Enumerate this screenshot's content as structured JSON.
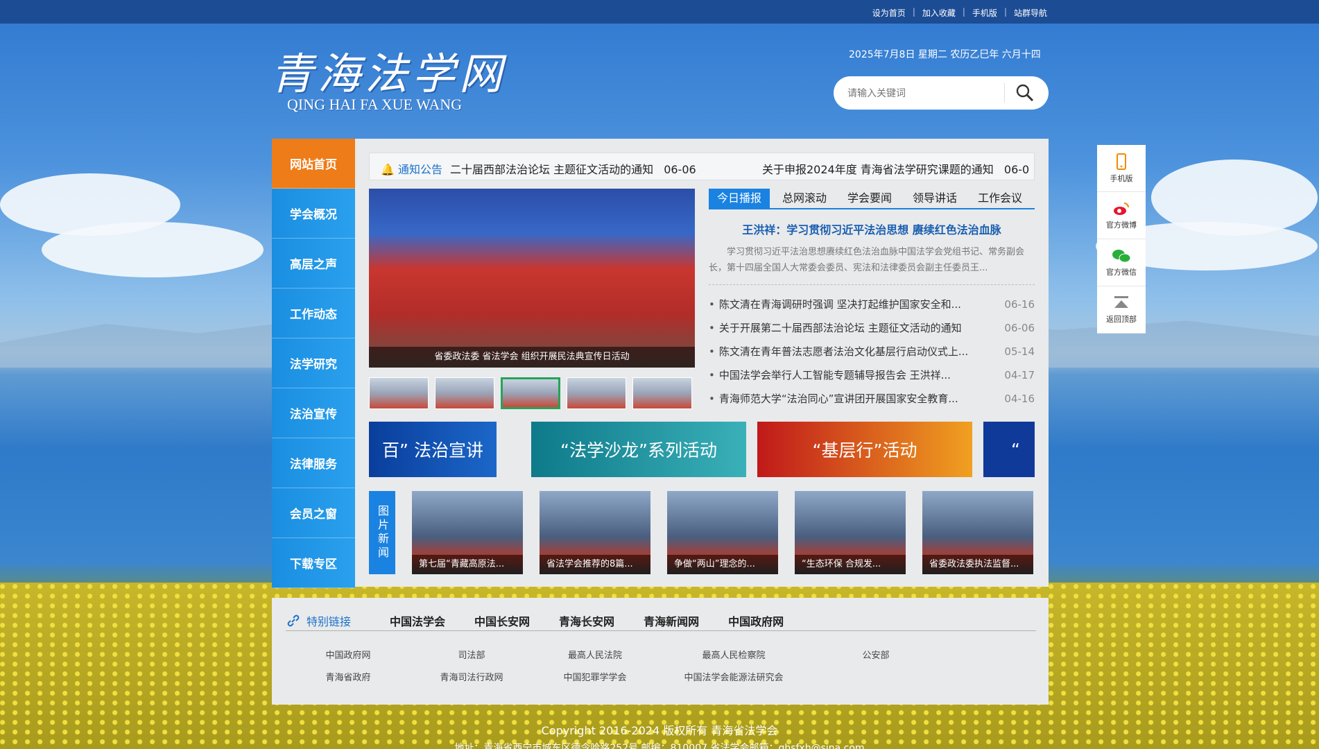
{
  "toplinks": [
    "设为首页",
    "加入收藏",
    "手机版",
    "站群导航"
  ],
  "logo": {
    "cn": "青海法学网",
    "en": "QING HAI FA XUE WANG"
  },
  "date": "2025年7月8日 星期二 农历乙巳年 六月十四",
  "search": {
    "placeholder": "请输入关键词"
  },
  "nav": [
    "网站首页",
    "学会概况",
    "高层之声",
    "工作动态",
    "法学研究",
    "法治宣传",
    "法律服务",
    "会员之窗",
    "下载专区"
  ],
  "notice": {
    "label": "通知公告",
    "items": [
      {
        "title": "二十届西部法治论坛 主题征文活动的通知",
        "date": "06-06"
      },
      {
        "title": "关于申报2024年度 青海省法学研究课题的通知",
        "date": "06-0"
      }
    ]
  },
  "slide": {
    "caption": "省委政法委 省法学会 组织开展民法典宣传日活动"
  },
  "tabs": [
    "今日播报",
    "总网滚动",
    "学会要闻",
    "领导讲话",
    "工作会议"
  ],
  "headline": "王洪祥：学习贯彻习近平法治思想 赓续红色法治血脉",
  "summary": "学习贯彻习近平法治思想赓续红色法治血脉中国法学会党组书记、常务副会长，第十四届全国人大常委会委员、宪法和法律委员会副主任委员王...",
  "news": [
    {
      "title": "陈文清在青海调研时强调 坚决打起维护国家安全和...",
      "date": "06-16"
    },
    {
      "title": "关于开展第二十届西部法治论坛 主题征文活动的通知",
      "date": "06-06"
    },
    {
      "title": "陈文清在青年普法志愿者法治文化基层行启动仪式上...",
      "date": "05-14"
    },
    {
      "title": "中国法学会举行人工智能专题辅导报告会 王洪祥...",
      "date": "04-17"
    },
    {
      "title": "青海师范大学“法治同心”宣讲团开展国家安全教育...",
      "date": "04-16"
    }
  ],
  "banners": [
    "百” 法治宣讲",
    "“法学沙龙”系列活动",
    "“基层行”活动",
    "“"
  ],
  "picnews": {
    "label": "图片新闻",
    "items": [
      "第七届“青藏高原法...",
      "省法学会推荐的8篇...",
      "争做“两山”理念的...",
      "“生态环保 合规发...",
      "省委政法委执法监督..."
    ]
  },
  "links": {
    "title": "特别链接",
    "head": [
      "中国法学会",
      "中国长安网",
      "青海长安网",
      "青海新闻网",
      "中国政府网"
    ],
    "row1": [
      "中国政府网",
      "司法部",
      "最高人民法院",
      "最高人民检察院",
      "公安部"
    ],
    "row2": [
      "青海省政府",
      "青海司法行政网",
      "中国犯罪学学会",
      "中国法学会能源法研究会"
    ]
  },
  "side": [
    "手机版",
    "官方微博",
    "官方微信",
    "返回顶部"
  ],
  "footer": {
    "copyright": "Copyright 2016-2024 版权所有  青海省法学会",
    "address": "地址：青海省西宁市城东区德令哈路252号  邮编：810007  省法学会邮箱：qhsfxh@sina.com"
  },
  "colors": {
    "accent": "#1a82e0",
    "nav_active": "#ee7c18",
    "topbar": "#1c4c94"
  }
}
